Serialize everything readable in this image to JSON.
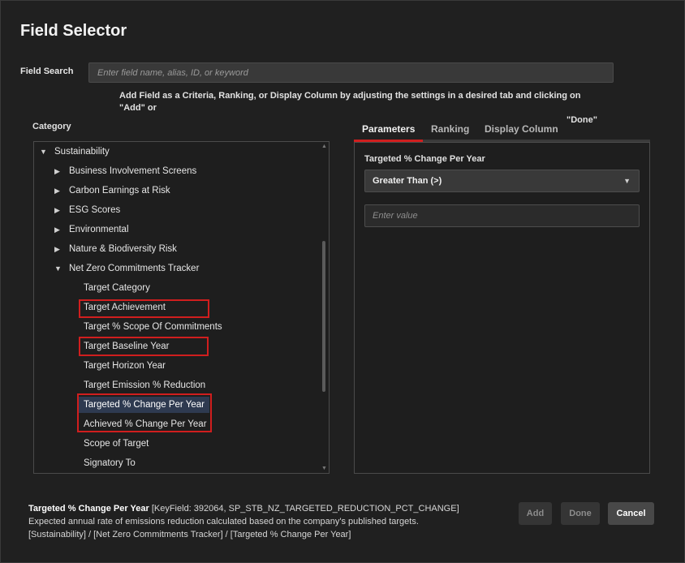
{
  "dialog": {
    "title": "Field Selector"
  },
  "search": {
    "label": "Field Search",
    "placeholder": "Enter field name, alias, ID, or keyword",
    "hint_line1": "Add Field as a Criteria, Ranking, or Display Column by adjusting the settings in a desired tab and clicking on \"Add\" or",
    "hint_line2": "\"Done\""
  },
  "category": {
    "label": "Category",
    "items": [
      {
        "label": "Sustainability",
        "expanded": true,
        "icon": "caret-down-icon"
      },
      {
        "label": "Business Involvement Screens",
        "expanded": false,
        "icon": "caret-right-icon"
      },
      {
        "label": "Carbon Earnings at Risk",
        "expanded": false,
        "icon": "caret-right-icon"
      },
      {
        "label": "ESG Scores",
        "expanded": false,
        "icon": "caret-right-icon"
      },
      {
        "label": "Environmental",
        "expanded": false,
        "icon": "caret-right-icon"
      },
      {
        "label": "Nature & Biodiversity Risk",
        "expanded": false,
        "icon": "caret-right-icon"
      },
      {
        "label": "Net Zero Commitments Tracker",
        "expanded": true,
        "icon": "caret-down-icon"
      },
      {
        "label": "Target Category"
      },
      {
        "label": "Target Achievement",
        "highlighted": true
      },
      {
        "label": "Target % Scope Of Commitments"
      },
      {
        "label": "Target Baseline Year",
        "highlighted": true
      },
      {
        "label": "Target Horizon Year"
      },
      {
        "label": "Target Emission % Reduction"
      },
      {
        "label": "Targeted % Change Per Year",
        "selected": true,
        "highlighted": true
      },
      {
        "label": "Achieved % Change Per Year",
        "highlighted": true
      },
      {
        "label": "Scope of Target"
      },
      {
        "label": "Signatory To"
      }
    ]
  },
  "tabs": [
    {
      "label": "Parameters",
      "active": true
    },
    {
      "label": "Ranking",
      "active": false
    },
    {
      "label": "Display Column",
      "active": false
    }
  ],
  "parameters": {
    "field_label": "Targeted % Change Per Year",
    "operator": "Greater Than (>)",
    "value_placeholder": "Enter value"
  },
  "footer": {
    "field_name": "Targeted % Change Per Year",
    "key_info": "[KeyField: 392064, SP_STB_NZ_TARGETED_REDUCTION_PCT_CHANGE]",
    "description": "Expected annual rate of emissions reduction calculated based on the company's published targets.",
    "path": "[Sustainability] / [Net Zero Commitments Tracker] / [Targeted % Change Per Year]"
  },
  "buttons": {
    "add": "Add",
    "done": "Done",
    "cancel": "Cancel"
  },
  "colors": {
    "accent": "#d01e1e",
    "background": "#202020",
    "selected_row": "#2e3a50"
  }
}
